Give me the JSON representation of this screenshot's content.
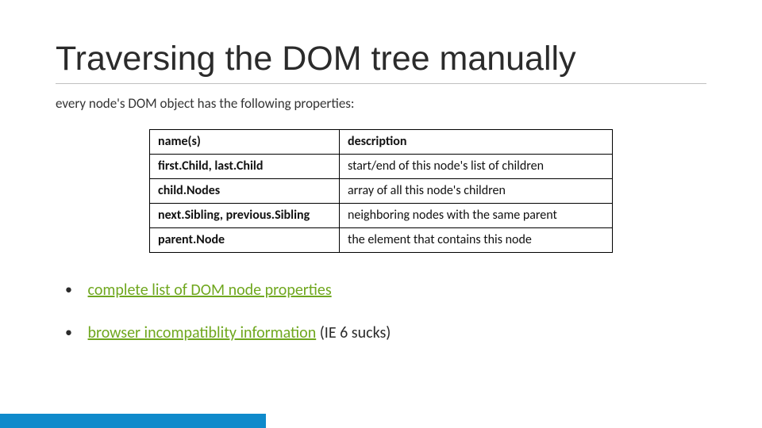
{
  "title": "Traversing the DOM tree manually",
  "intro": "every node's DOM object has the following properties:",
  "table": {
    "headers": {
      "name": "name(s)",
      "desc": "description"
    },
    "rows": [
      {
        "name": "first.Child, last.Child",
        "desc": "start/end of this node's list of children"
      },
      {
        "name": "child.Nodes",
        "desc": "array of all this node's children"
      },
      {
        "name": "next.Sibling, previous.Sibling",
        "desc": "neighboring nodes with the same parent"
      },
      {
        "name": "parent.Node",
        "desc": "the element that contains this node"
      }
    ]
  },
  "bullets": [
    {
      "link": "complete list of DOM node properties",
      "tail": ""
    },
    {
      "link": "browser incompatiblity information",
      "tail": " (IE 6 sucks)"
    }
  ]
}
